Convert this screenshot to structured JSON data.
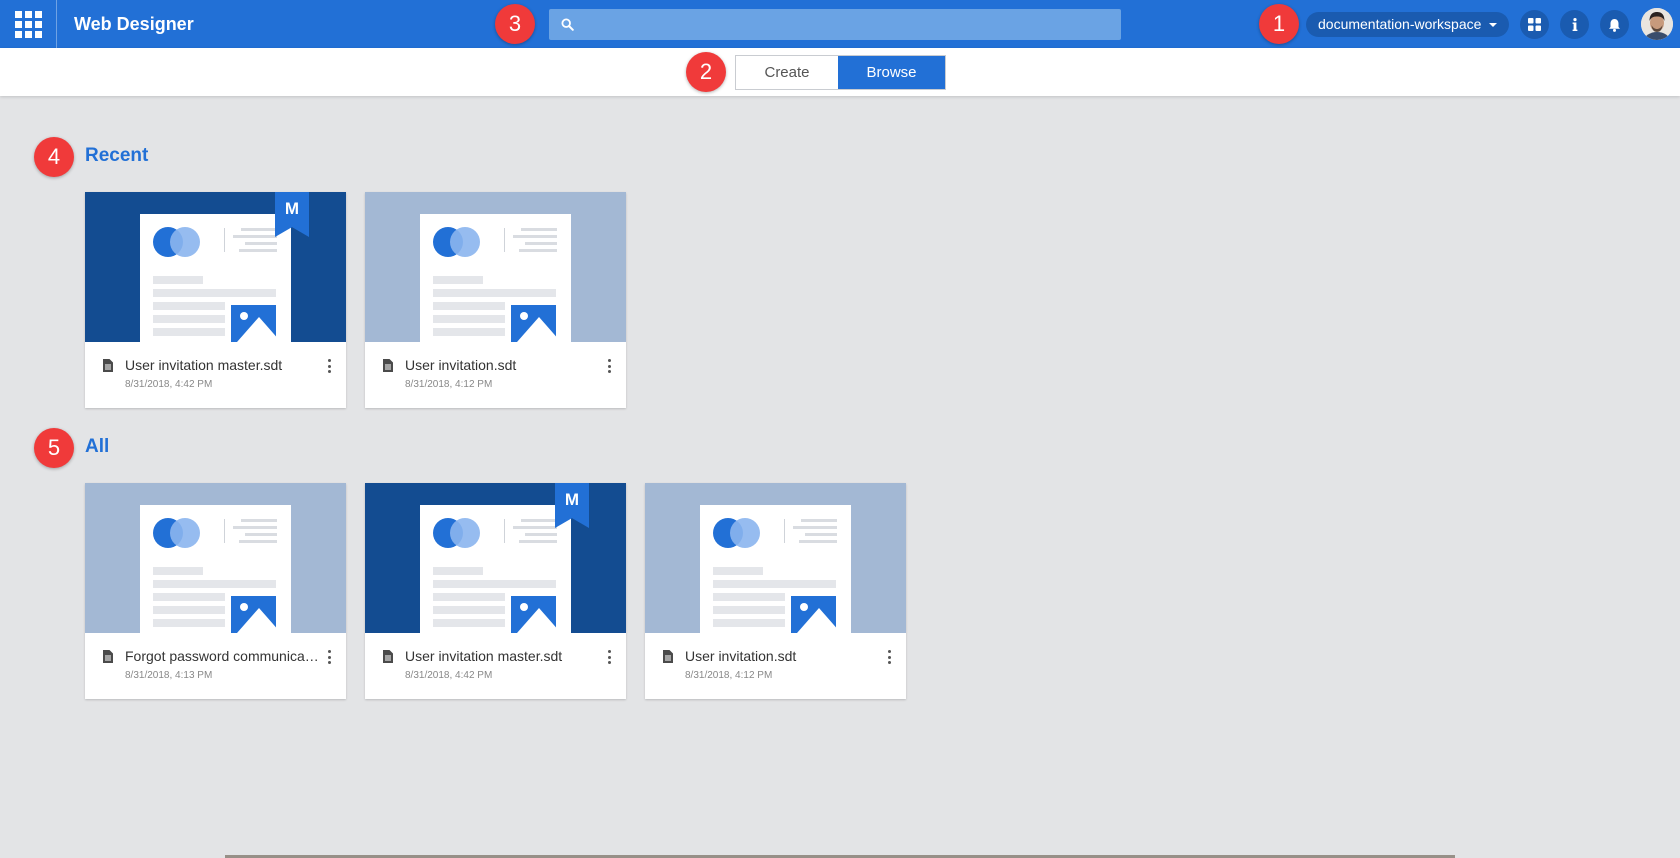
{
  "header": {
    "app_title": "Web Designer",
    "search_placeholder": "",
    "workspace": "documentation-workspace",
    "icons": [
      "apps-grid-icon",
      "search-icon",
      "dashboard-icon",
      "info-icon",
      "bell-icon",
      "avatar"
    ]
  },
  "mode_tabs": [
    {
      "label": "Create",
      "active": false
    },
    {
      "label": "Browse",
      "active": true
    }
  ],
  "markers": [
    "1",
    "2",
    "3",
    "4",
    "5"
  ],
  "sections": {
    "recent": {
      "title": "Recent",
      "cards": [
        {
          "name": "User invitation master.sdt",
          "date": "8/31/2018, 4:42 PM",
          "master": true,
          "badge": "M"
        },
        {
          "name": "User invitation.sdt",
          "date": "8/31/2018, 4:12 PM",
          "master": false
        }
      ]
    },
    "all": {
      "title": "All",
      "cards": [
        {
          "name": "Forgot password communicat…",
          "date": "8/31/2018, 4:13 PM",
          "master": false
        },
        {
          "name": "User invitation master.sdt",
          "date": "8/31/2018, 4:42 PM",
          "master": true,
          "badge": "M"
        },
        {
          "name": "User invitation.sdt",
          "date": "8/31/2018, 4:12 PM",
          "master": false
        }
      ]
    }
  },
  "colors": {
    "primary": "#2270d6",
    "master_thumb": "#134c91",
    "normal_thumb": "#a3b8d4",
    "marker": "#f03a3a",
    "background": "#e3e4e6"
  }
}
